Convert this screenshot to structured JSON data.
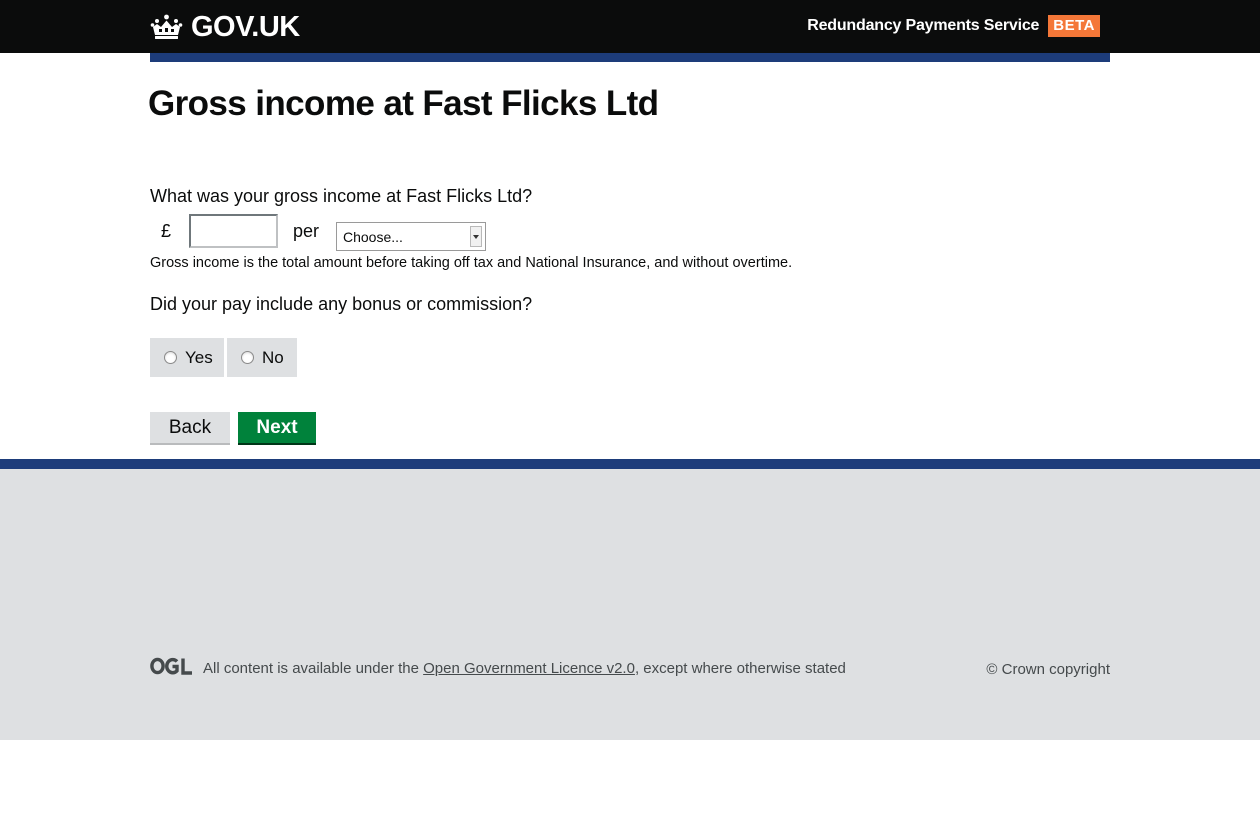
{
  "header": {
    "logo_text": "GOV.UK",
    "service_name": "Redundancy Payments Service",
    "phase_tag": "BETA",
    "crown_icon": "crown-icon"
  },
  "main": {
    "title": "Gross income at Fast Flicks Ltd",
    "income_question": "What was your gross income at Fast Flicks Ltd?",
    "currency_symbol": "£",
    "amount_value": "",
    "per_label": "per",
    "period_select": {
      "selected": "Choose..."
    },
    "income_hint": "Gross income is the total amount before taking off tax and National Insurance, and without overtime.",
    "bonus_question": "Did your pay include any bonus or commission?",
    "bonus_options": [
      "Yes",
      "No"
    ],
    "back_label": "Back",
    "next_label": "Next"
  },
  "footer": {
    "licence_prefix": "All content is available under the ",
    "licence_link": "Open Government Licence v2.0",
    "licence_suffix": ", except where otherwise stated",
    "copyright": "© Crown copyright",
    "ogl_icon": "ogl-logo-icon"
  },
  "colors": {
    "header_bg": "#0b0c0c",
    "beta_tag": "#f47738",
    "rule_blue": "#1d3c7a",
    "next_button": "#00823b",
    "footer_bg": "#dee0e2"
  }
}
